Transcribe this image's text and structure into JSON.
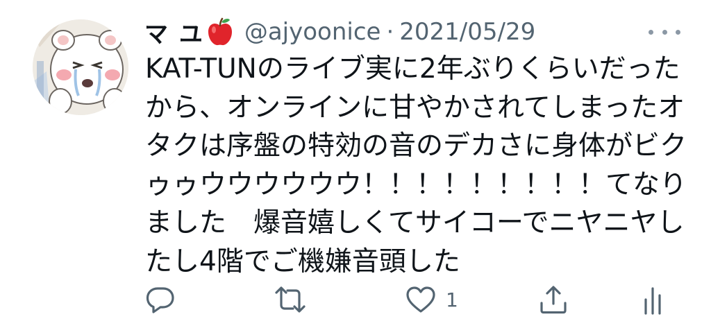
{
  "tweet": {
    "display_name": "マ ユ",
    "name_emoji_icon": "red-apple-icon",
    "handle": "@ajyoonice",
    "separator": "·",
    "date": "2021/05/29",
    "text": "KAT-TUNのライブ実に2年ぶりくらいだったから、オンラインに甘やかされてしまったオタクは序盤の特効の音のデカさに身体がビクゥゥウウウウウウ！！！！！！！！！てなりました　爆音嬉しくてサイコーでニヤニヤしたし4階でご機嫌音頭した"
  },
  "actions": {
    "reply_icon": "speech-bubble-icon",
    "retweet_icon": "retweet-icon",
    "like_icon": "heart-icon",
    "like_count": "1",
    "share_icon": "share-icon",
    "analytics_icon": "bar-chart-icon"
  },
  "colors": {
    "text": "#0f1419",
    "muted": "#536471",
    "icon": "#536471",
    "apple": "#e0242b"
  }
}
